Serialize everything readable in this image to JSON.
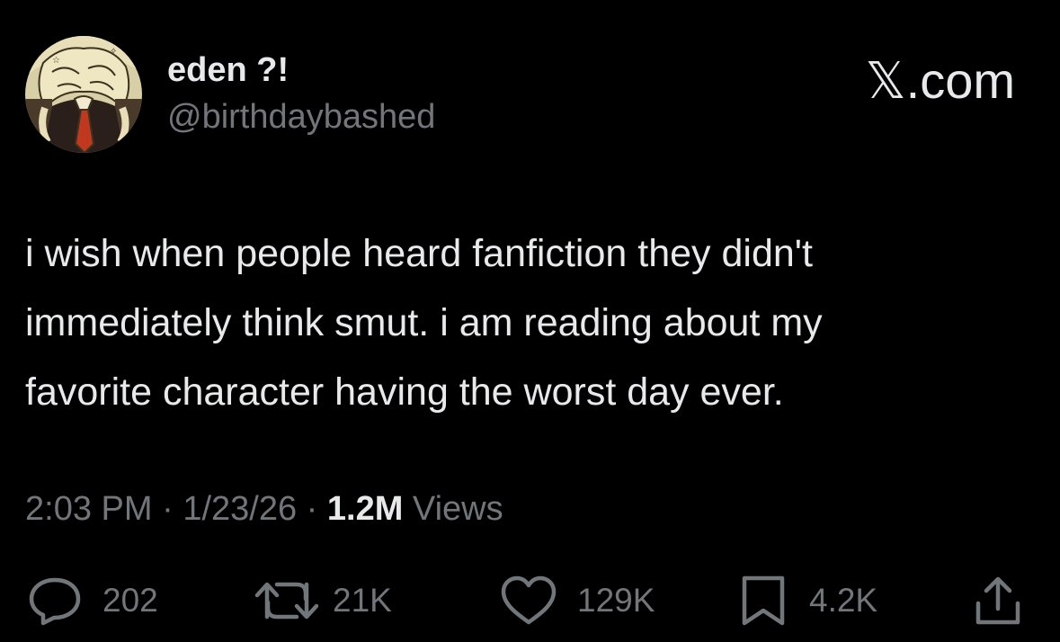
{
  "author": {
    "display_name": "eden ?!",
    "handle": "@birthdaybashed",
    "avatar_icon": "illustrated-character-avatar"
  },
  "brand": {
    "x_glyph": "𝕏",
    "domain": ".com"
  },
  "tweet": {
    "text": "i wish when people heard fanfiction they didn't\nimmediately think smut. i am reading about my\nfavorite character having the worst day ever."
  },
  "meta": {
    "time": "2:03 PM",
    "separator": " · ",
    "date": "1/23/26",
    "views_count": "1.2M",
    "views_label": " Views"
  },
  "actions": {
    "reply": {
      "icon": "reply-icon",
      "count": "202"
    },
    "repost": {
      "icon": "repost-icon",
      "count": "21K"
    },
    "like": {
      "icon": "heart-icon",
      "count": "129K"
    },
    "bookmark": {
      "icon": "bookmark-icon",
      "count": "4.2K"
    },
    "share": {
      "icon": "share-icon"
    }
  },
  "colors": {
    "background": "#000000",
    "primary_text": "#e7e9ea",
    "secondary_text": "#71767b"
  }
}
